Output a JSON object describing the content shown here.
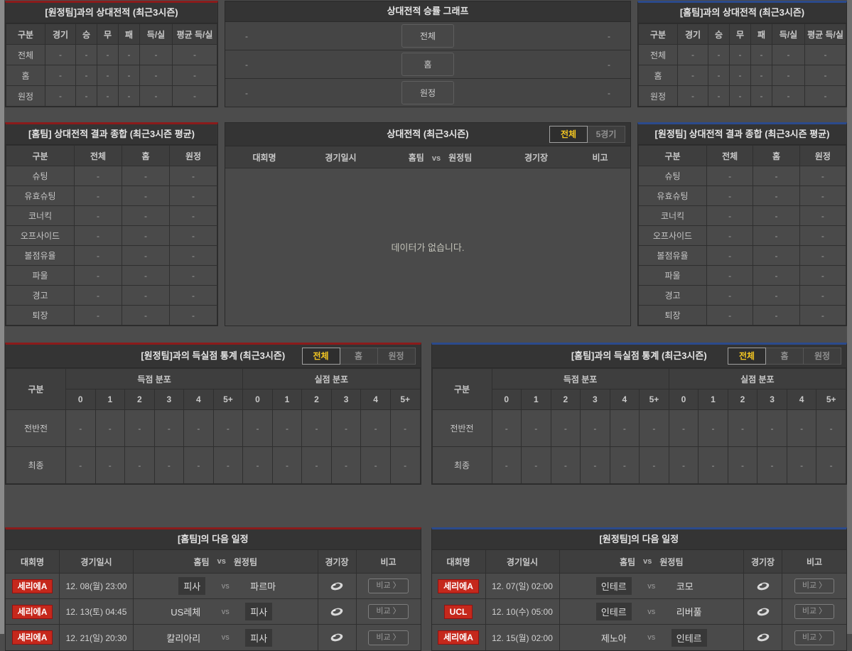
{
  "ui": {
    "vs": "vs",
    "compare_label": "비교 〉"
  },
  "colors": {
    "accent_red": "#8b1b1b",
    "accent_blue": "#2b4a8c",
    "badge_red": "#c5281c",
    "tab_active_yellow": "#f3c622"
  },
  "panels": {
    "away_h2h": {
      "title": "[원정팀]과의 상대전적 (최근3시즌)",
      "columns": [
        "구분",
        "경기",
        "승",
        "무",
        "패",
        "득/실",
        "평균 득/실"
      ],
      "rows": [
        {
          "label": "전체",
          "values": [
            "-",
            "-",
            "-",
            "-",
            "-",
            "-"
          ]
        },
        {
          "label": "홈",
          "values": [
            "-",
            "-",
            "-",
            "-",
            "-",
            "-"
          ]
        },
        {
          "label": "원정",
          "values": [
            "-",
            "-",
            "-",
            "-",
            "-",
            "-"
          ]
        }
      ]
    },
    "winrate_graph": {
      "title": "상대전적 승률 그래프",
      "rows": [
        {
          "left": "-",
          "label": "전체",
          "right": "-"
        },
        {
          "left": "-",
          "label": "홈",
          "right": "-"
        },
        {
          "left": "-",
          "label": "원정",
          "right": "-"
        }
      ]
    },
    "home_h2h": {
      "title": "[홈팀]과의 상대전적 (최근3시즌)",
      "columns": [
        "구분",
        "경기",
        "승",
        "무",
        "패",
        "득/실",
        "평균 득/실"
      ],
      "rows": [
        {
          "label": "전체",
          "values": [
            "-",
            "-",
            "-",
            "-",
            "-",
            "-"
          ]
        },
        {
          "label": "홈",
          "values": [
            "-",
            "-",
            "-",
            "-",
            "-",
            "-"
          ]
        },
        {
          "label": "원정",
          "values": [
            "-",
            "-",
            "-",
            "-",
            "-",
            "-"
          ]
        }
      ]
    },
    "home_summary": {
      "title": "[홈팀] 상대전적 결과 종합 (최근3시즌 평균)",
      "columns": [
        "구분",
        "전체",
        "홈",
        "원정"
      ],
      "rows": [
        {
          "label": "슈팅",
          "values": [
            "-",
            "-",
            "-"
          ]
        },
        {
          "label": "유효슈팅",
          "values": [
            "-",
            "-",
            "-"
          ]
        },
        {
          "label": "코너킥",
          "values": [
            "-",
            "-",
            "-"
          ]
        },
        {
          "label": "오프사이드",
          "values": [
            "-",
            "-",
            "-"
          ]
        },
        {
          "label": "볼점유율",
          "values": [
            "-",
            "-",
            "-"
          ]
        },
        {
          "label": "파울",
          "values": [
            "-",
            "-",
            "-"
          ]
        },
        {
          "label": "경고",
          "values": [
            "-",
            "-",
            "-"
          ]
        },
        {
          "label": "퇴장",
          "values": [
            "-",
            "-",
            "-"
          ]
        }
      ]
    },
    "h2h_matches": {
      "title": "상대전적 (최근3시즌)",
      "tabs": [
        "전체",
        "5경기"
      ],
      "columns": {
        "league": "대회명",
        "datetime": "경기일시",
        "home": "홈팀",
        "vs": "vs",
        "away": "원정팀",
        "stadium": "경기장",
        "note": "비고"
      },
      "empty_text": "데이터가 없습니다."
    },
    "away_summary": {
      "title": "[원정팀] 상대전적 결과 종합 (최근3시즌 평균)",
      "columns": [
        "구분",
        "전체",
        "홈",
        "원정"
      ],
      "rows": [
        {
          "label": "슈팅",
          "values": [
            "-",
            "-",
            "-"
          ]
        },
        {
          "label": "유효슈팅",
          "values": [
            "-",
            "-",
            "-"
          ]
        },
        {
          "label": "코너킥",
          "values": [
            "-",
            "-",
            "-"
          ]
        },
        {
          "label": "오프사이드",
          "values": [
            "-",
            "-",
            "-"
          ]
        },
        {
          "label": "볼점유율",
          "values": [
            "-",
            "-",
            "-"
          ]
        },
        {
          "label": "파울",
          "values": [
            "-",
            "-",
            "-"
          ]
        },
        {
          "label": "경고",
          "values": [
            "-",
            "-",
            "-"
          ]
        },
        {
          "label": "퇴장",
          "values": [
            "-",
            "-",
            "-"
          ]
        }
      ]
    },
    "away_goals": {
      "title": "[원정팀]과의 득실점 통계 (최근3시즌)",
      "tabs": [
        "전체",
        "홈",
        "원정"
      ],
      "corner": "구분",
      "groups": [
        "득점 분포",
        "실점 분포"
      ],
      "sub_columns": [
        "0",
        "1",
        "2",
        "3",
        "4",
        "5+",
        "0",
        "1",
        "2",
        "3",
        "4",
        "5+"
      ],
      "rows": [
        {
          "label": "전반전",
          "values": [
            "-",
            "-",
            "-",
            "-",
            "-",
            "-",
            "-",
            "-",
            "-",
            "-",
            "-",
            "-"
          ]
        },
        {
          "label": "최종",
          "values": [
            "-",
            "-",
            "-",
            "-",
            "-",
            "-",
            "-",
            "-",
            "-",
            "-",
            "-",
            "-"
          ]
        }
      ]
    },
    "home_goals": {
      "title": "[홈팀]과의 득실점 통계 (최근3시즌)",
      "tabs": [
        "전체",
        "홈",
        "원정"
      ],
      "corner": "구분",
      "groups": [
        "득점 분포",
        "실점 분포"
      ],
      "sub_columns": [
        "0",
        "1",
        "2",
        "3",
        "4",
        "5+",
        "0",
        "1",
        "2",
        "3",
        "4",
        "5+"
      ],
      "rows": [
        {
          "label": "전반전",
          "values": [
            "-",
            "-",
            "-",
            "-",
            "-",
            "-",
            "-",
            "-",
            "-",
            "-",
            "-",
            "-"
          ]
        },
        {
          "label": "최종",
          "values": [
            "-",
            "-",
            "-",
            "-",
            "-",
            "-",
            "-",
            "-",
            "-",
            "-",
            "-",
            "-"
          ]
        }
      ]
    },
    "home_schedule": {
      "title": "[홈팀]의 다음 일정",
      "columns": {
        "league": "대회명",
        "datetime": "경기일시",
        "home": "홈팀",
        "vs": "vs",
        "away": "원정팀",
        "stadium": "경기장",
        "note": "비고"
      },
      "rows": [
        {
          "league": "세리에A",
          "datetime": "12. 08(월) 23:00",
          "home": "피사",
          "away": "파르마"
        },
        {
          "league": "세리에A",
          "datetime": "12. 13(토) 04:45",
          "home": "US레체",
          "away": "피사"
        },
        {
          "league": "세리에A",
          "datetime": "12. 21(일) 20:30",
          "home": "칼리아리",
          "away": "피사"
        }
      ]
    },
    "away_schedule": {
      "title": "[원정팀]의 다음 일정",
      "columns": {
        "league": "대회명",
        "datetime": "경기일시",
        "home": "홈팀",
        "vs": "vs",
        "away": "원정팀",
        "stadium": "경기장",
        "note": "비고"
      },
      "rows": [
        {
          "league": "세리에A",
          "datetime": "12. 07(일) 02:00",
          "home": "인테르",
          "away": "코모"
        },
        {
          "league": "UCL",
          "datetime": "12. 10(수) 05:00",
          "home": "인테르",
          "away": "리버풀"
        },
        {
          "league": "세리에A",
          "datetime": "12. 15(월) 02:00",
          "home": "제노아",
          "away": "인테르"
        }
      ]
    }
  }
}
